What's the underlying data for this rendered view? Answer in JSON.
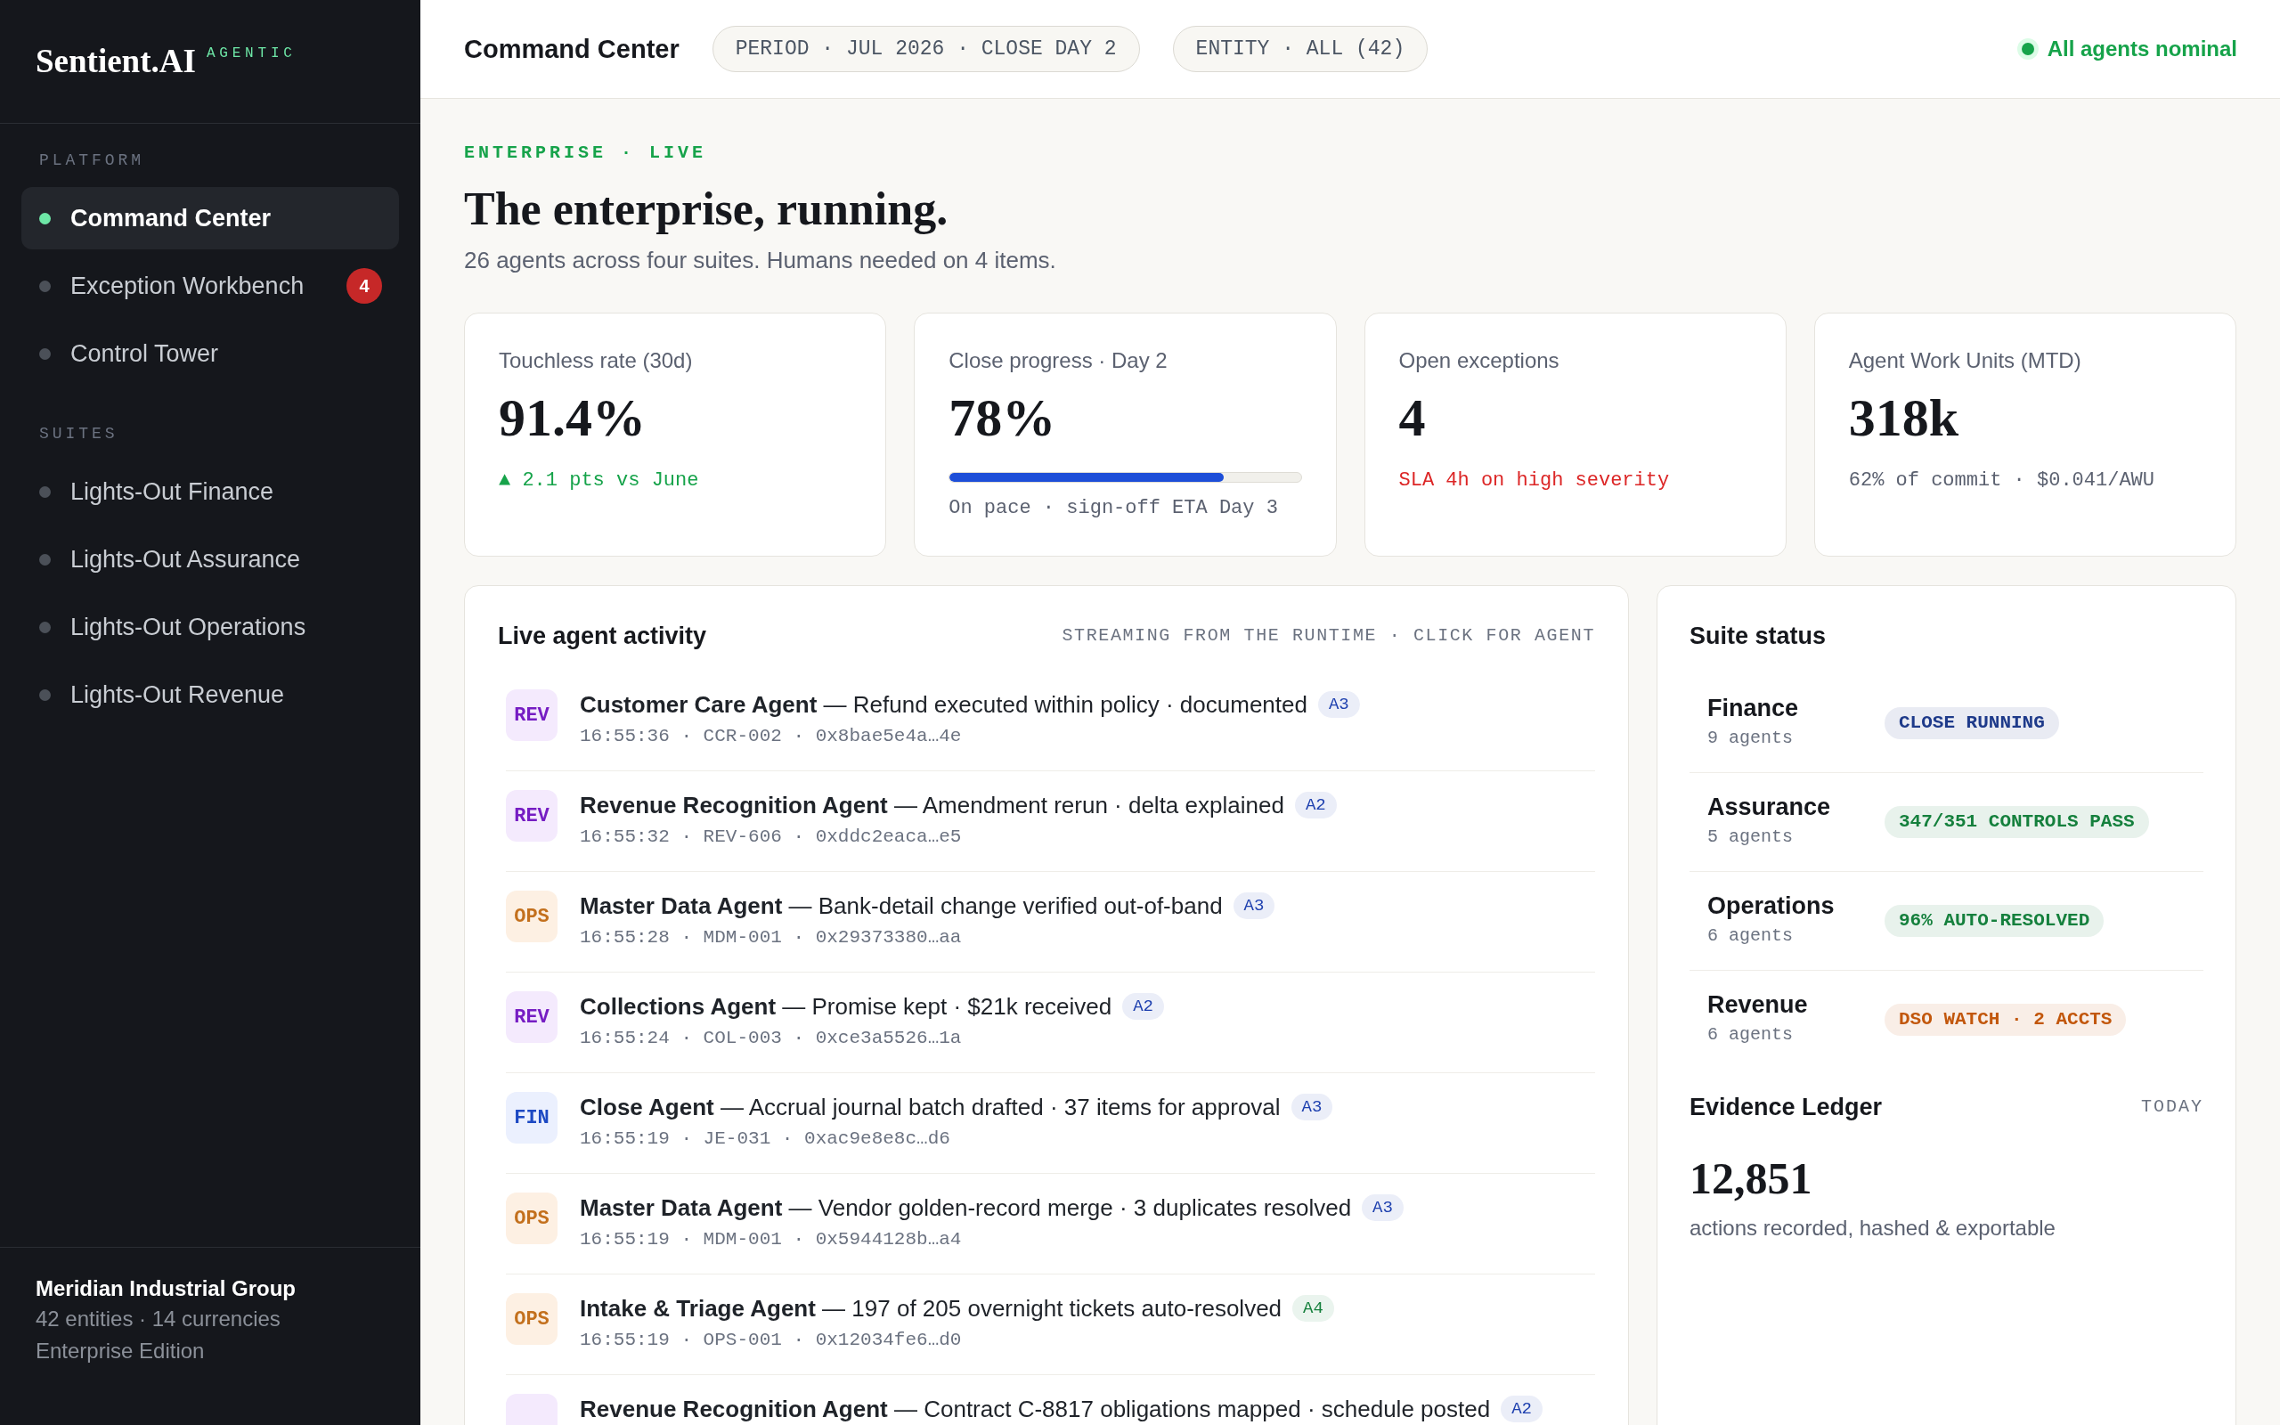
{
  "sidebar": {
    "logo": "Sentient.AI",
    "logo_tag": "AGENTIC",
    "sections": [
      {
        "heading": "PLATFORM",
        "items": [
          {
            "label": "Command Center",
            "selected": true
          },
          {
            "label": "Exception Workbench",
            "selected": false,
            "badge": "4"
          },
          {
            "label": "Control Tower",
            "selected": false
          }
        ]
      },
      {
        "heading": "SUITES",
        "items": [
          {
            "label": "Lights-Out Finance",
            "selected": false
          },
          {
            "label": "Lights-Out Assurance",
            "selected": false
          },
          {
            "label": "Lights-Out Operations",
            "selected": false
          },
          {
            "label": "Lights-Out Revenue",
            "selected": false
          }
        ]
      }
    ],
    "org": {
      "name": "Meridian Industrial Group",
      "details": "42 entities · 14 currencies",
      "edition": "Enterprise Edition"
    }
  },
  "header": {
    "title": "Command Center",
    "filters": [
      "PERIOD · JUL 2026 · CLOSE DAY 2",
      "ENTITY · ALL (42)"
    ],
    "status": "All agents nominal"
  },
  "hero": {
    "eyebrow": "ENTERPRISE · LIVE",
    "title": "The enterprise, running.",
    "subtitle": "26 agents across four suites. Humans needed on 4 items."
  },
  "kpis": [
    {
      "kind": "delta",
      "label": "Touchless rate (30d)",
      "value": "91.4%",
      "note": "▲ 2.1 pts vs June"
    },
    {
      "kind": "progress",
      "label": "Close progress · Day 2",
      "value": "78%",
      "level": 0.78,
      "note": "On pace · sign-off ETA Day 3"
    },
    {
      "kind": "alert",
      "label": "Open exceptions",
      "value": "4",
      "note": "SLA 4h on high severity"
    },
    {
      "kind": "plain",
      "label": "Agent Work Units (MTD)",
      "value": "318k",
      "note": "62% of commit · $0.041/AWU"
    }
  ],
  "activity": {
    "title": "Live agent activity",
    "caption": "STREAMING FROM THE RUNTIME · CLICK FOR AGENT",
    "items": [
      {
        "tag": {
          "text": "REV",
          "color": "#f4eafd"
        },
        "text": "**Customer Care Agent** — Refund executed within policy · documented",
        "badge": {
          "text": "A3",
          "color": "#1e40af"
        },
        "meta": "16:55:36 · CCR-002 · 0x8bae5e4a…4e"
      },
      {
        "tag": {
          "text": "REV",
          "color": "#f4eafd"
        },
        "text": "**Revenue Recognition Agent** — Amendment rerun · delta explained",
        "badge": {
          "text": "A2",
          "color": "#1e40af"
        },
        "meta": "16:55:32 · REV-606 · 0xddc2eaca…e5"
      },
      {
        "tag": {
          "text": "OPS",
          "color": "#fdf0e3"
        },
        "text": "**Master Data Agent** — Bank-detail change verified out-of-band",
        "badge": {
          "text": "A3",
          "color": "#1e40af"
        },
        "meta": "16:55:28 · MDM-001 · 0x29373380…aa"
      },
      {
        "tag": {
          "text": "REV",
          "color": "#f4eafd"
        },
        "text": "**Collections Agent** — Promise kept · $21k received",
        "badge": {
          "text": "A2",
          "color": "#1e40af"
        },
        "meta": "16:55:24 · COL-003 · 0xce3a5526…1a"
      },
      {
        "tag": {
          "text": "FIN",
          "color": "#ebf0fe"
        },
        "text": "**Close Agent** — Accrual journal batch drafted · 37 items for approval",
        "badge": {
          "text": "A3",
          "color": "#1e40af"
        },
        "meta": "16:55:19 · JE-031 · 0xac9e8e8c…d6"
      },
      {
        "tag": {
          "text": "OPS",
          "color": "#fdf0e3"
        },
        "text": "**Master Data Agent** — Vendor golden-record merge · 3 duplicates resolved",
        "badge": {
          "text": "A3",
          "color": "#1e40af"
        },
        "meta": "16:55:19 · MDM-001 · 0x5944128b…a4"
      },
      {
        "tag": {
          "text": "OPS",
          "color": "#fdf0e3"
        },
        "text": "**Intake & Triage Agent** — 197 of 205 overnight tickets auto-resolved",
        "badge": {
          "text": "A4",
          "color": "#15803d"
        },
        "meta": "16:55:19 · OPS-001 · 0x12034fe6…d0"
      },
      {
        "tag": {
          "color": "#f4eafd"
        },
        "text": "**Revenue Recognition Agent** — Contract C-8817 obligations mapped · schedule posted",
        "badge": {
          "text": "A2",
          "color": "#1e40af"
        }
      }
    ]
  },
  "suite_status": {
    "title": "Suite status",
    "suites": [
      {
        "name": "Finance",
        "agents": "9 agents",
        "status": "CLOSE RUNNING",
        "color": "#1e3a8a"
      },
      {
        "name": "Assurance",
        "agents": "5 agents",
        "status": "347/351 CONTROLS PASS",
        "color": "#15803d"
      },
      {
        "name": "Operations",
        "agents": "6 agents",
        "status": "96% AUTO-RESOLVED",
        "color": "#15803d"
      },
      {
        "name": "Revenue",
        "agents": "6 agents",
        "status": "DSO WATCH · 2 ACCTS",
        "color": "#c2570c"
      }
    ]
  },
  "evidence_ledger": {
    "title": "Evidence Ledger",
    "period": "TODAY",
    "value": "12,851",
    "caption": "actions recorded, hashed & exportable"
  }
}
